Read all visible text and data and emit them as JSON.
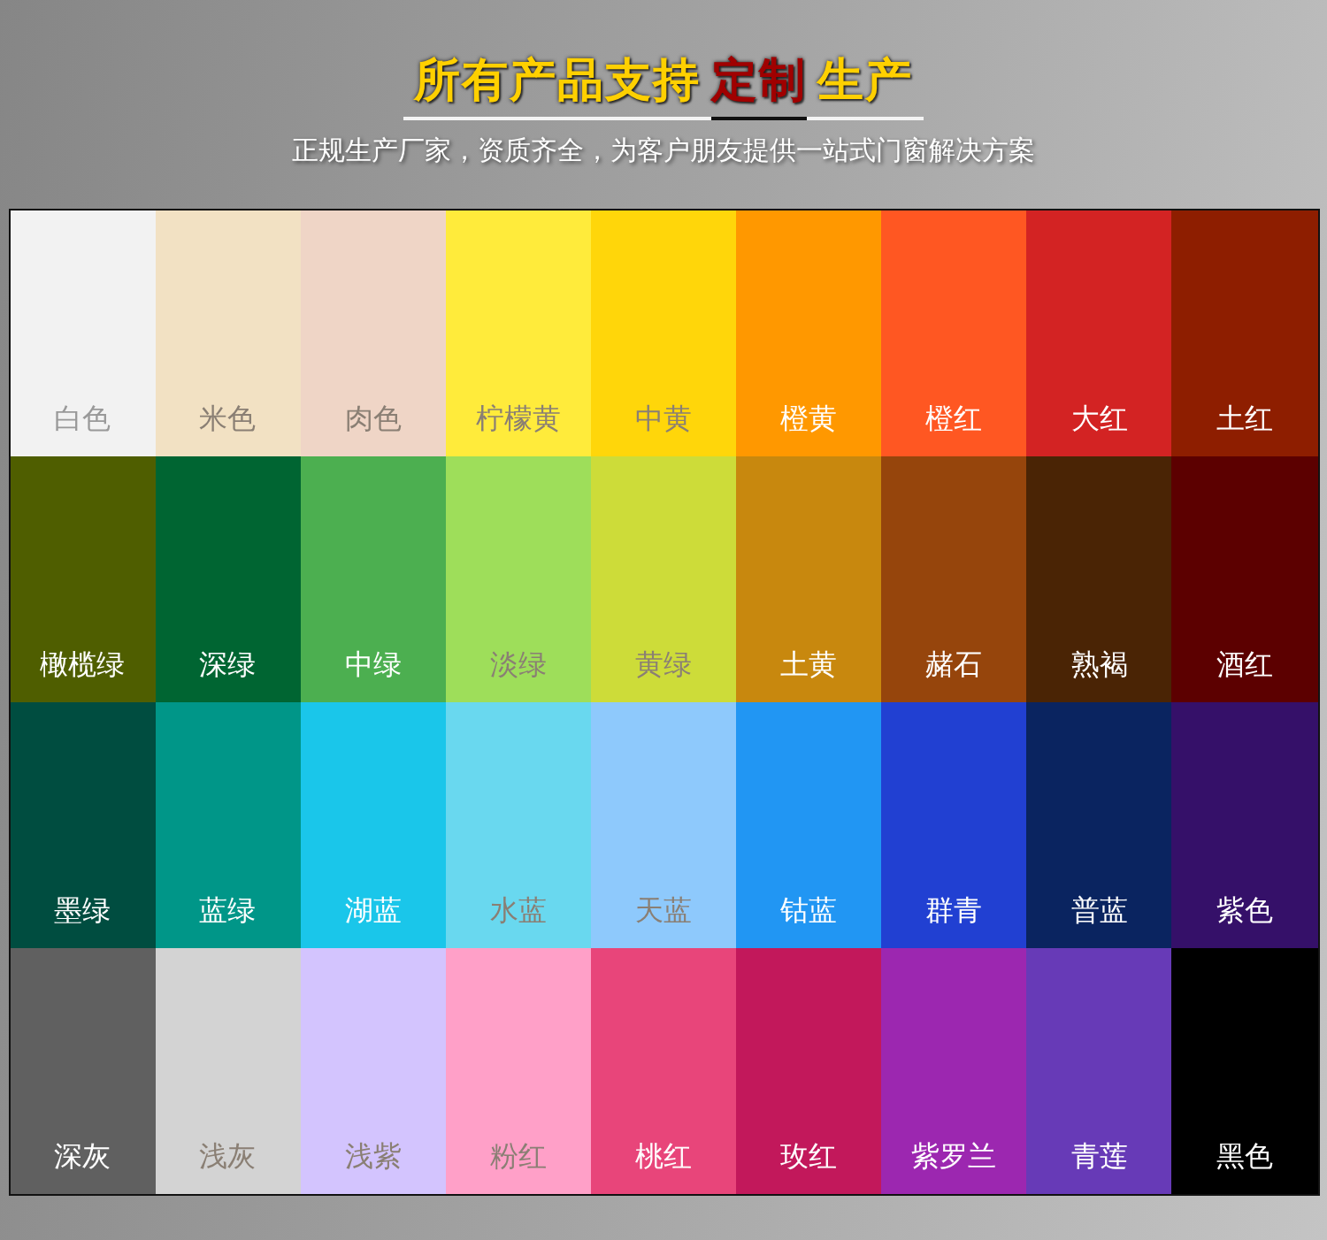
{
  "header": {
    "title": [
      {
        "text": "所有产品支持",
        "highlight": false
      },
      {
        "text": "定制",
        "highlight": true
      },
      {
        "text": "生产",
        "highlight": false
      }
    ],
    "subtitle": "正规生产厂家，资质齐全，为客户朋友提供一站式门窗解决方案"
  },
  "swatches": [
    {
      "name": "白色",
      "color": "#f2f2f2"
    },
    {
      "name": "米色",
      "color": "#f2e1c3"
    },
    {
      "name": "肉色",
      "color": "#efd5c6"
    },
    {
      "name": "柠檬黄",
      "color": "#ffeb3b"
    },
    {
      "name": "中黄",
      "color": "#ffd60a"
    },
    {
      "name": "橙黄",
      "color": "#ff9800"
    },
    {
      "name": "橙红",
      "color": "#ff5722"
    },
    {
      "name": "大红",
      "color": "#d32323"
    },
    {
      "name": "土红",
      "color": "#8e1e00"
    },
    {
      "name": "橄榄绿",
      "color": "#4f5e00"
    },
    {
      "name": "深绿",
      "color": "#006532"
    },
    {
      "name": "中绿",
      "color": "#4caf50"
    },
    {
      "name": "淡绿",
      "color": "#9ede5a"
    },
    {
      "name": "黄绿",
      "color": "#cddc39"
    },
    {
      "name": "土黄",
      "color": "#c8880e"
    },
    {
      "name": "赭石",
      "color": "#96450c"
    },
    {
      "name": "熟褐",
      "color": "#4a2405"
    },
    {
      "name": "酒红",
      "color": "#5c0000"
    },
    {
      "name": "墨绿",
      "color": "#004d40"
    },
    {
      "name": "蓝绿",
      "color": "#009688"
    },
    {
      "name": "湖蓝",
      "color": "#1ac6ea"
    },
    {
      "name": "水蓝",
      "color": "#69d8ef"
    },
    {
      "name": "天蓝",
      "color": "#8ec9fc"
    },
    {
      "name": "钴蓝",
      "color": "#2196f3"
    },
    {
      "name": "群青",
      "color": "#2140d2"
    },
    {
      "name": "普蓝",
      "color": "#0a2460"
    },
    {
      "name": "紫色",
      "color": "#351069"
    },
    {
      "name": "深灰",
      "color": "#606060"
    },
    {
      "name": "浅灰",
      "color": "#d3d3d3"
    },
    {
      "name": "浅紫",
      "color": "#d3c4fe"
    },
    {
      "name": "粉红",
      "color": "#ffa0c8"
    },
    {
      "name": "桃红",
      "color": "#e8457a"
    },
    {
      "name": "玫红",
      "color": "#c2185b"
    },
    {
      "name": "紫罗兰",
      "color": "#9c27b0"
    },
    {
      "name": "青莲",
      "color": "#673ab7"
    },
    {
      "name": "黑色",
      "color": "#000000"
    }
  ]
}
